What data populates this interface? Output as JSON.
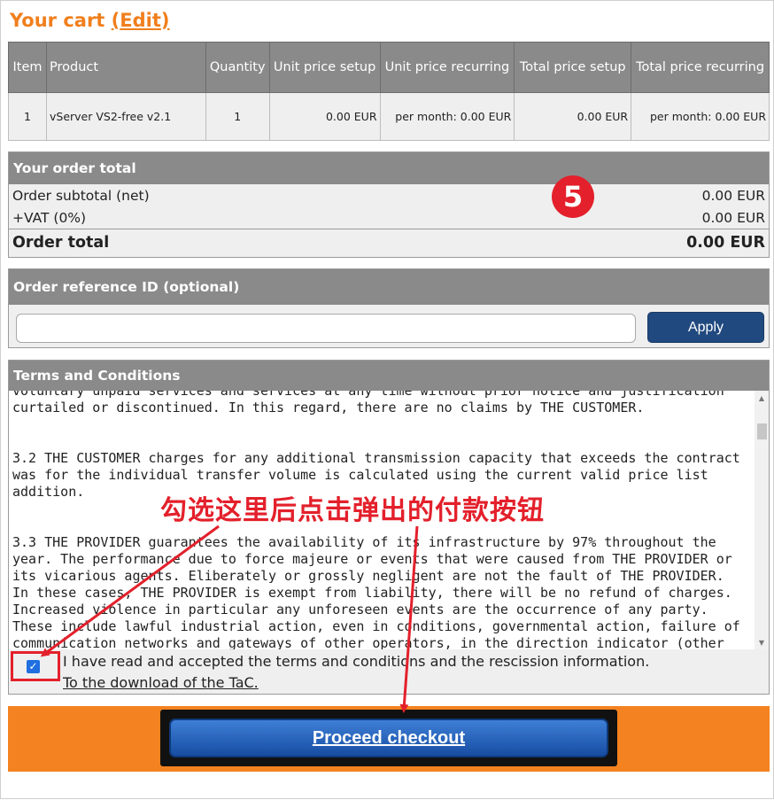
{
  "cart": {
    "title": "Your cart",
    "edit_open": "(",
    "edit_label": "Edit",
    "edit_close": ")"
  },
  "table": {
    "headers": [
      "Item",
      "Product",
      "Quantity",
      "Unit price setup",
      "Unit price recurring",
      "Total price setup",
      "Total price recurring"
    ],
    "rows": [
      {
        "item": "1",
        "product": "vServer VS2-free v2.1",
        "quantity": "1",
        "unit_setup": "0.00 EUR",
        "unit_recurring": "per month: 0.00 EUR",
        "total_setup": "0.00 EUR",
        "total_recurring": "per month: 0.00 EUR"
      }
    ]
  },
  "order_total": {
    "heading": "Your order total",
    "subtotal_label": "Order subtotal (net)",
    "subtotal_value": "0.00 EUR",
    "vat_label": "+VAT (0%)",
    "vat_value": "0.00 EUR",
    "total_label": "Order total",
    "total_value": "0.00 EUR"
  },
  "badge": "5",
  "order_reference": {
    "heading": "Order reference ID (optional)",
    "input_value": "",
    "apply_label": "Apply"
  },
  "terms": {
    "heading": "Terms and Conditions",
    "text": "voluntary unpaid services and services at any time without prior notice and justification\ncurtailed or discontinued. In this regard, there are no claims by THE CUSTOMER.\n\n\n3.2 THE CUSTOMER charges for any additional transmission capacity that exceeds the contract\nwas for the individual transfer volume is calculated using the current valid price list\naddition.\n\n\n3.3 THE PROVIDER guarantees the availability of its infrastructure by 97% throughout the\nyear. The performance due to force majeure or events that were caused from THE PROVIDER or\nits vicarious agents. Eliberately or grossly negligent are not the fault of THE PROVIDER.\nIn these cases, THE PROVIDER is exempt from liability, there will be no refund of charges.\nIncreased violence in particular any unforeseen events are the occurrence of any party.\nThese include lawful industrial action, even in conditions, governmental action, failure of\ncommunication networks and gateways of other operators, in the direction indicator (other",
    "accept_label": "I have read and accepted the terms and conditions and the rescission information.",
    "accept_checked": true,
    "download_link": "To the download of the TaC."
  },
  "checkout": {
    "label": "Proceed checkout"
  },
  "annotation": {
    "text": "勾选这里后点击弹出的付款按钮"
  },
  "colors": {
    "accent_orange": "#f58220",
    "title_orange": "#f07f1d",
    "button_blue": "#20497f",
    "annotation_red": "#e3202b"
  }
}
